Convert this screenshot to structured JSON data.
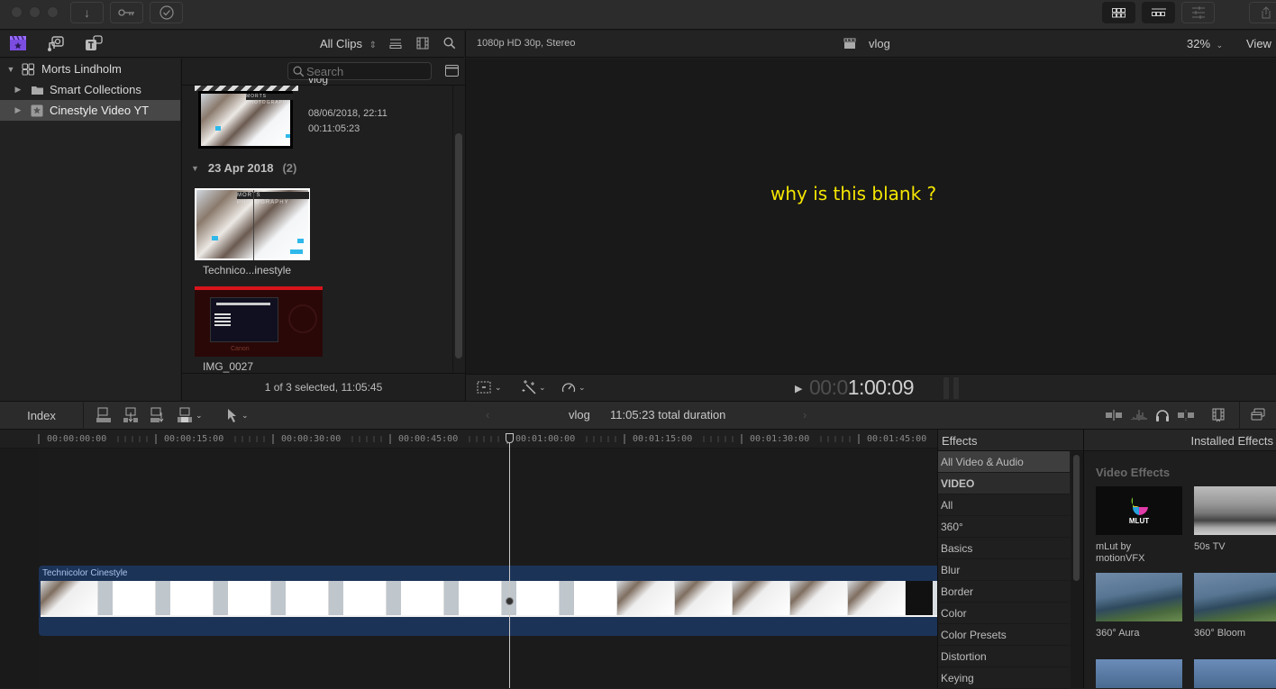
{
  "titlebar": {
    "buttons": [
      {
        "name": "import-button",
        "icon": "download-arrow-icon",
        "glyph": "↓"
      },
      {
        "name": "keywords-button",
        "icon": "key-icon",
        "glyph": "⚿"
      },
      {
        "name": "background-tasks-button",
        "icon": "checkmark-circle-icon",
        "glyph": "✓"
      }
    ],
    "layout_buttons": [
      {
        "name": "browser-layout-button",
        "icon": "grid-icon",
        "glyph": "▦"
      },
      {
        "name": "timeline-layout-button",
        "icon": "timeline-icon",
        "glyph": "▭"
      },
      {
        "name": "inspector-layout-button",
        "icon": "sliders-icon",
        "glyph": "☰"
      }
    ]
  },
  "library_bar": {
    "filter_label": "All Clips",
    "filter_glyph": "⌃⌄"
  },
  "sidebar": {
    "items": [
      {
        "label": "Morts Lindholm",
        "icon": "library-icon",
        "expanded": true
      },
      {
        "label": "Smart Collections",
        "icon": "folder-icon",
        "expanded": false
      },
      {
        "label": "Cinestyle Video YT",
        "icon": "star-event-icon",
        "expanded": false,
        "selected": true
      }
    ]
  },
  "browser": {
    "search_placeholder": "Search",
    "clips": [
      {
        "title": "vlog",
        "date": "08/06/2018, 22:11",
        "duration": "00:11:05:23"
      }
    ],
    "groups": [
      {
        "label": "23 Apr 2018",
        "count": "(2)",
        "clips": [
          {
            "title": "Technico...inestyle"
          },
          {
            "title": "IMG_0027"
          }
        ]
      }
    ],
    "status": "1 of 3 selected, 11:05:45"
  },
  "viewer": {
    "format": "1080p HD 30p, Stereo",
    "project_name": "vlog",
    "zoom": "32%",
    "view_label": "View",
    "annotation": "why is this blank ?",
    "annotation_color": "#f5e600",
    "timecode_dim": "00:0",
    "timecode_bright": "1:00:09"
  },
  "timeline_toolbar": {
    "index_label": "Index",
    "project_name": "vlog",
    "total_duration": "11:05:23 total duration"
  },
  "ruler": {
    "ticks": [
      "00:00:00:00",
      "00:00:15:00",
      "00:00:30:00",
      "00:00:45:00",
      "00:01:00:00",
      "00:01:15:00",
      "00:01:30:00",
      "00:01:45:00"
    ]
  },
  "timeline": {
    "clip_name": "Technicolor Cinestyle",
    "clip_color": "#1c3358",
    "playhead_timecode": "00:01:00:00"
  },
  "effects": {
    "title": "Effects",
    "installed_title": "Installed Effects",
    "categories": [
      {
        "label": "All Video & Audio",
        "selected": true
      },
      {
        "label": "VIDEO",
        "header": true
      },
      {
        "label": "All"
      },
      {
        "label": "360°"
      },
      {
        "label": "Basics"
      },
      {
        "label": "Blur"
      },
      {
        "label": "Border"
      },
      {
        "label": "Color"
      },
      {
        "label": "Color Presets"
      },
      {
        "label": "Distortion"
      },
      {
        "label": "Keying"
      }
    ],
    "section_label": "Video Effects",
    "items": [
      {
        "label": "mLut by motionVFX",
        "thumb_text": "MLUT"
      },
      {
        "label": "50s TV"
      },
      {
        "label": "360° Aura"
      },
      {
        "label": "360° Bloom"
      },
      {
        "label": ""
      },
      {
        "label": ""
      }
    ]
  }
}
